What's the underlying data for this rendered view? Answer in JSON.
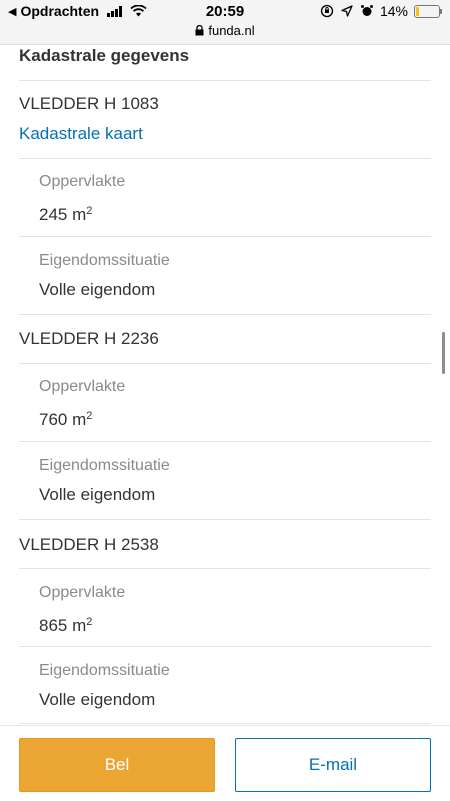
{
  "status_bar": {
    "back_label": "Opdrachten",
    "time": "20:59",
    "battery_text": "14%",
    "battery_level": 0.14,
    "battery_color": "#f1c40f",
    "url": "funda.nl"
  },
  "section": {
    "title": "Kadastrale gegevens"
  },
  "parcels": [
    {
      "id": "VLEDDER H 1083",
      "map_link": "Kadastrale kaart",
      "area_label": "Oppervlakte",
      "area_value": "245 m",
      "area_unit_sup": "2",
      "ownership_label": "Eigendomssituatie",
      "ownership_value": "Volle eigendom"
    },
    {
      "id": "VLEDDER H 2236",
      "area_label": "Oppervlakte",
      "area_value": "760 m",
      "area_unit_sup": "2",
      "ownership_label": "Eigendomssituatie",
      "ownership_value": "Volle eigendom"
    },
    {
      "id": "VLEDDER H 2538",
      "area_label": "Oppervlakte",
      "area_value": "865 m",
      "area_unit_sup": "2",
      "ownership_label": "Eigendomssituatie",
      "ownership_value": "Volle eigendom"
    }
  ],
  "actions": {
    "call_label": "Bel",
    "email_label": "E-mail"
  },
  "colors": {
    "accent_orange": "#eaa533",
    "link_blue": "#0071b3"
  }
}
